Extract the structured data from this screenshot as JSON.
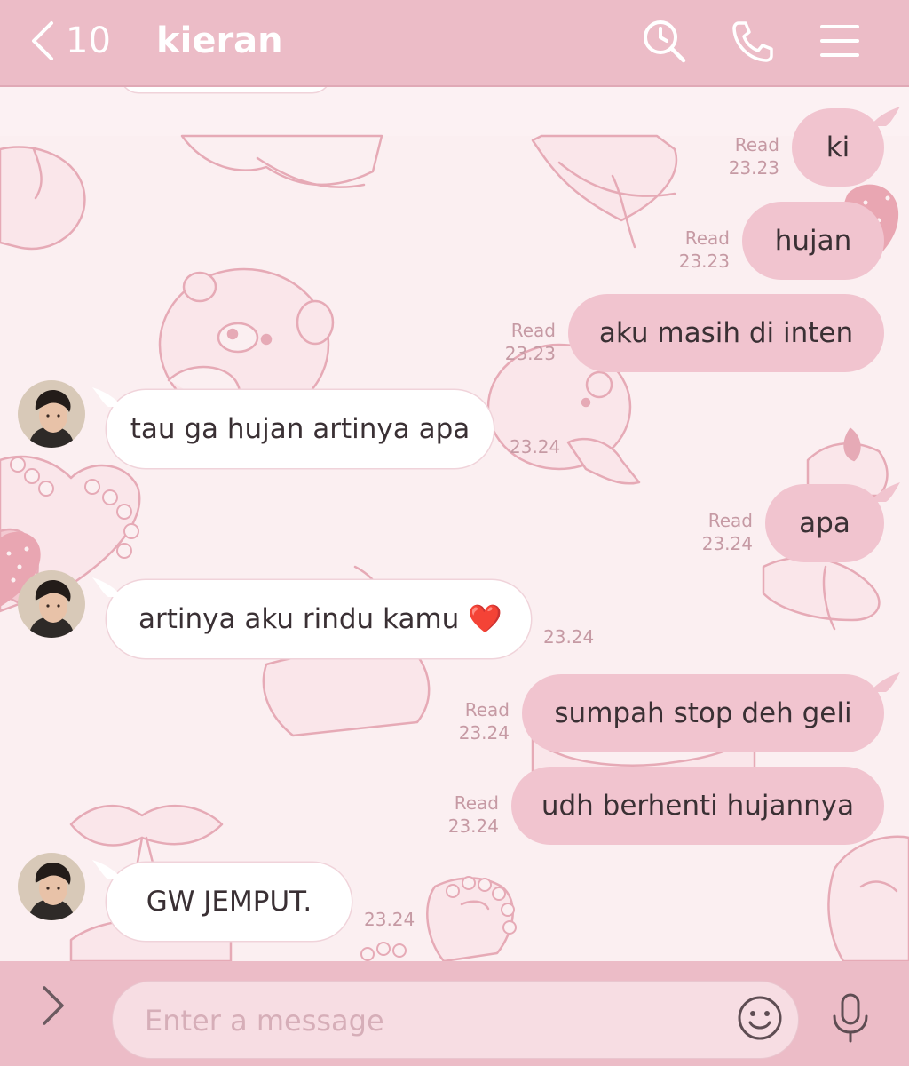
{
  "header": {
    "back_count": "10",
    "title": "kieran"
  },
  "messages": [
    {
      "side": "out",
      "text": "ki",
      "read": "Read",
      "time": "23.23"
    },
    {
      "side": "out",
      "text": "hujan",
      "read": "Read",
      "time": "23.23"
    },
    {
      "side": "out",
      "text": "aku masih di inten",
      "read": "Read",
      "time": "23.23"
    },
    {
      "side": "in",
      "text": "tau ga hujan artinya apa",
      "time": "23.24"
    },
    {
      "side": "out",
      "text": "apa",
      "read": "Read",
      "time": "23.24"
    },
    {
      "side": "in",
      "text": "artinya aku rindu kamu ❤️",
      "time": "23.24"
    },
    {
      "side": "out",
      "text": "sumpah stop deh geli",
      "read": "Read",
      "time": "23.24"
    },
    {
      "side": "out",
      "text": "udh berhenti hujannya",
      "read": "Read",
      "time": "23.24"
    },
    {
      "side": "in",
      "text": "GW JEMPUT.",
      "time": "23.24"
    }
  ],
  "composer": {
    "placeholder": "Enter a message"
  },
  "colors": {
    "header_bg": "#ecbcc7",
    "outgoing_bubble": "#f1c4cf",
    "incoming_bubble": "#ffffff",
    "chat_bg": "#fcf1f3"
  },
  "icons": [
    "back-chevron-icon",
    "search-icon",
    "phone-icon",
    "menu-icon",
    "expand-chevron-icon",
    "emoji-icon",
    "microphone-icon"
  ]
}
